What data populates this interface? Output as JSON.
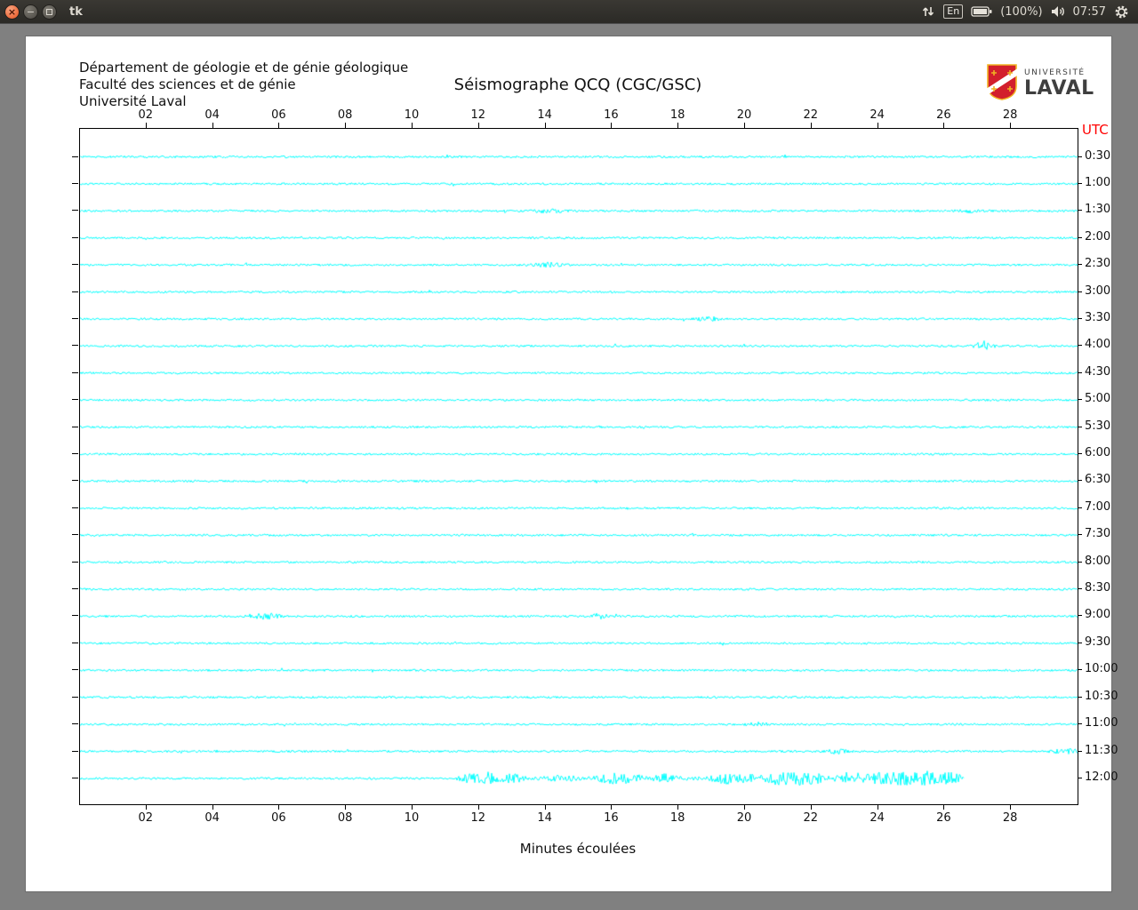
{
  "taskbar": {
    "window_title": "tk",
    "language": "En",
    "battery_percent": "(100%)",
    "time": "07:57"
  },
  "header": {
    "dept_line1": "Département de géologie et de génie géologique",
    "dept_line2": "Faculté des sciences et de génie",
    "dept_line3": "Université Laval",
    "title": "Séismographe QCQ (CGC/GSC)",
    "logo_top": "UNIVERSITÉ",
    "logo_bottom": "LAVAL"
  },
  "chart_data": {
    "type": "line",
    "title": "Séismographe QCQ (CGC/GSC)",
    "xlabel": "Minutes écoulées",
    "y_axis_right_label": "UTC",
    "x_ticks": [
      "02",
      "04",
      "06",
      "08",
      "10",
      "12",
      "14",
      "16",
      "18",
      "20",
      "22",
      "24",
      "26",
      "28"
    ],
    "x_range_minutes": [
      0,
      30
    ],
    "row_interval_minutes": 30,
    "trace_color": "#00ffff",
    "base_noise": 1.15,
    "rows": [
      {
        "utc": "0:30"
      },
      {
        "utc": "1:00"
      },
      {
        "utc": "1:30"
      },
      {
        "utc": "2:00"
      },
      {
        "utc": "2:30"
      },
      {
        "utc": "3:00"
      },
      {
        "utc": "3:30"
      },
      {
        "utc": "4:00"
      },
      {
        "utc": "4:30"
      },
      {
        "utc": "5:00"
      },
      {
        "utc": "5:30"
      },
      {
        "utc": "6:00"
      },
      {
        "utc": "6:30"
      },
      {
        "utc": "7:00"
      },
      {
        "utc": "7:30"
      },
      {
        "utc": "8:00"
      },
      {
        "utc": "8:30"
      },
      {
        "utc": "9:00"
      },
      {
        "utc": "9:30"
      },
      {
        "utc": "10:00"
      },
      {
        "utc": "10:30"
      },
      {
        "utc": "11:00"
      },
      {
        "utc": "11:30"
      },
      {
        "utc": "12:00",
        "end_min": 26.6,
        "active": [
          11.5,
          26.6
        ],
        "active_extra_noise": 1.0
      }
    ],
    "events": [
      {
        "row": 2,
        "min": 14.1,
        "amp": 2.2,
        "sigma": 0.3
      },
      {
        "row": 2,
        "min": 26.7,
        "amp": 1.8,
        "sigma": 0.25
      },
      {
        "row": 4,
        "min": 14.1,
        "amp": 2.2,
        "sigma": 0.3
      },
      {
        "row": 6,
        "min": 18.9,
        "amp": 3.0,
        "sigma": 0.2
      },
      {
        "row": 7,
        "min": 27.2,
        "amp": 5.0,
        "sigma": 0.18
      },
      {
        "row": 17,
        "min": 5.6,
        "amp": 3.5,
        "sigma": 0.25
      },
      {
        "row": 17,
        "min": 15.6,
        "amp": 2.5,
        "sigma": 0.2
      },
      {
        "row": 21,
        "min": 20.3,
        "amp": 2.4,
        "sigma": 0.2
      },
      {
        "row": 22,
        "min": 22.8,
        "amp": 2.4,
        "sigma": 0.2
      },
      {
        "row": 22,
        "min": 29.6,
        "amp": 2.8,
        "sigma": 0.3
      },
      {
        "row": 23,
        "min": 11.7,
        "amp": 4.0,
        "sigma": 0.25
      },
      {
        "row": 23,
        "min": 12.3,
        "amp": 5.0,
        "sigma": 0.2
      },
      {
        "row": 23,
        "min": 13.0,
        "amp": 4.0,
        "sigma": 0.2
      },
      {
        "row": 23,
        "min": 14.5,
        "amp": 3.0,
        "sigma": 0.25
      },
      {
        "row": 23,
        "min": 16.0,
        "amp": 5.0,
        "sigma": 0.25
      },
      {
        "row": 23,
        "min": 16.6,
        "amp": 4.0,
        "sigma": 0.2
      },
      {
        "row": 23,
        "min": 17.6,
        "amp": 3.5,
        "sigma": 0.2
      },
      {
        "row": 23,
        "min": 19.4,
        "amp": 5.0,
        "sigma": 0.25
      },
      {
        "row": 23,
        "min": 20.1,
        "amp": 4.0,
        "sigma": 0.2
      },
      {
        "row": 23,
        "min": 21.0,
        "amp": 6.0,
        "sigma": 0.28
      },
      {
        "row": 23,
        "min": 21.6,
        "amp": 5.0,
        "sigma": 0.2
      },
      {
        "row": 23,
        "min": 22.1,
        "amp": 4.0,
        "sigma": 0.2
      },
      {
        "row": 23,
        "min": 23.2,
        "amp": 6.0,
        "sigma": 0.28
      },
      {
        "row": 23,
        "min": 24.1,
        "amp": 5.0,
        "sigma": 0.25
      },
      {
        "row": 23,
        "min": 24.7,
        "amp": 6.0,
        "sigma": 0.25
      },
      {
        "row": 23,
        "min": 25.4,
        "amp": 6.5,
        "sigma": 0.28
      },
      {
        "row": 23,
        "min": 26.2,
        "amp": 5.5,
        "sigma": 0.22
      }
    ]
  }
}
